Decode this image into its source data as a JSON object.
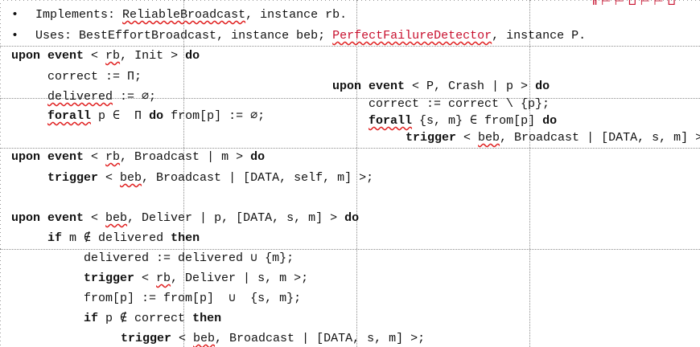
{
  "header_corner_text": "Ⅱ ⊢ ⊢ ⊔ ⊢ ⊢ ⊔",
  "bullets": {
    "implements_label": "Implements:",
    "implements_name": "ReliableBroadcast",
    "implements_suffix": ", instance rb.",
    "uses_label": "Uses:",
    "uses_beb": "BestEffortBroadcast",
    "uses_mid": ", instance beb;",
    "uses_pfd": "PerfectFailureDetector",
    "uses_suffix": ", instance P."
  },
  "init_block": {
    "upon_event": "upon event",
    "open": "< ",
    "rb": "rb",
    "rest": ", Init >",
    "do": "do",
    "correct": "correct := Π;",
    "delivered_a": "delivered",
    "delivered_b": " := ∅;",
    "forall": "forall",
    "forall_mid": " p ∈  Π ",
    "forall_do": "do",
    "forall_rest": " from[p] := ∅;"
  },
  "crash_block": {
    "upon_event": "upon event",
    "head": " < P, Crash | p >",
    "do": "do",
    "correct": "correct := correct \\ {p};",
    "forall": "forall",
    "forall_mid": " {s, m} ∈ from[p] ",
    "forall_do": "do",
    "trigger": "trigger",
    "trigger_open": " < ",
    "beb": "beb",
    "trigger_rest": ", Broadcast | [DATA, s, m] >;"
  },
  "broadcast_block": {
    "upon_event": "upon event",
    "open": " < ",
    "rb": "rb",
    "rest": ", Broadcast | m >",
    "do": "do",
    "trigger": "trigger",
    "trigger_open": " < ",
    "beb": "beb",
    "trigger_rest": ", Broadcast | [DATA, self, m] >;"
  },
  "deliver_block": {
    "upon_event": "upon event",
    "open": " < ",
    "beb": "beb",
    "rest": ", Deliver | p, [DATA, s, m] >",
    "do": "do",
    "if": "if",
    "if_mid": " m ∉ delivered ",
    "then": "then",
    "delivered_line": "delivered := delivered ∪ {m};",
    "trigger1": "trigger",
    "trigger1_open": " < ",
    "rb": "rb",
    "trigger1_rest": ", Deliver | s, m >;",
    "from_line": "from[p] := from[p]  ∪  {s, m};",
    "if2": "if",
    "if2_mid": " p ∉ correct ",
    "then2": "then",
    "trigger2": "trigger",
    "trigger2_open": " < ",
    "beb2": "beb",
    "trigger2_rest": ", Broadcast | [DATA, s, m] >;"
  }
}
